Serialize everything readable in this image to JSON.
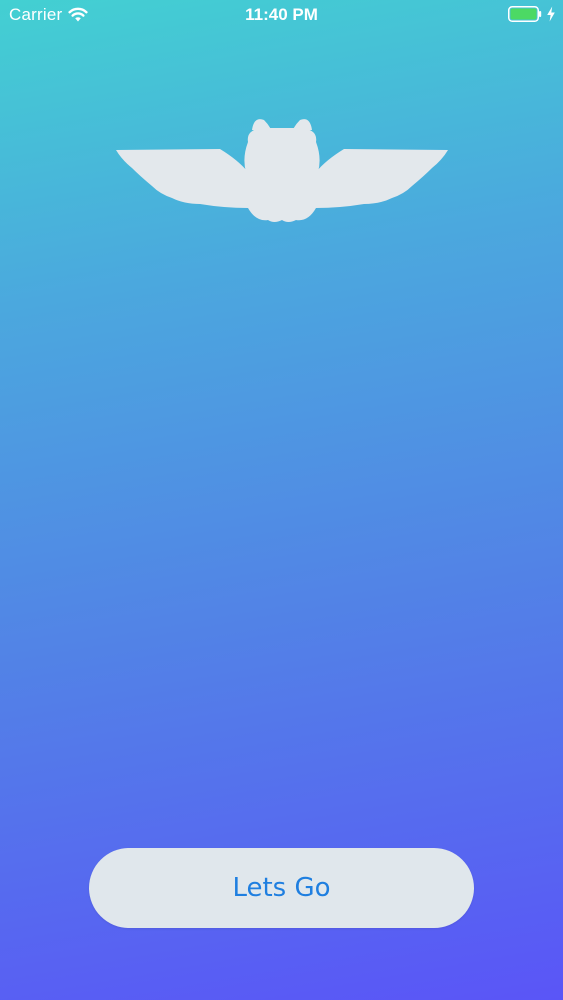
{
  "status_bar": {
    "carrier": "Carrier",
    "time": "11:40 PM",
    "wifi_icon": "wifi-icon",
    "battery_icon": "battery-charging-icon",
    "battery_level": 1.0,
    "battery_color": "#4cd964"
  },
  "logo": {
    "icon": "winged-owl-logo",
    "color": "#e3e8ec"
  },
  "main": {
    "button_label": "Lets Go",
    "button_color": "#1f7fe0"
  },
  "colors": {
    "gradient_top": "#43d0d2",
    "gradient_bottom": "#5a55f7"
  }
}
